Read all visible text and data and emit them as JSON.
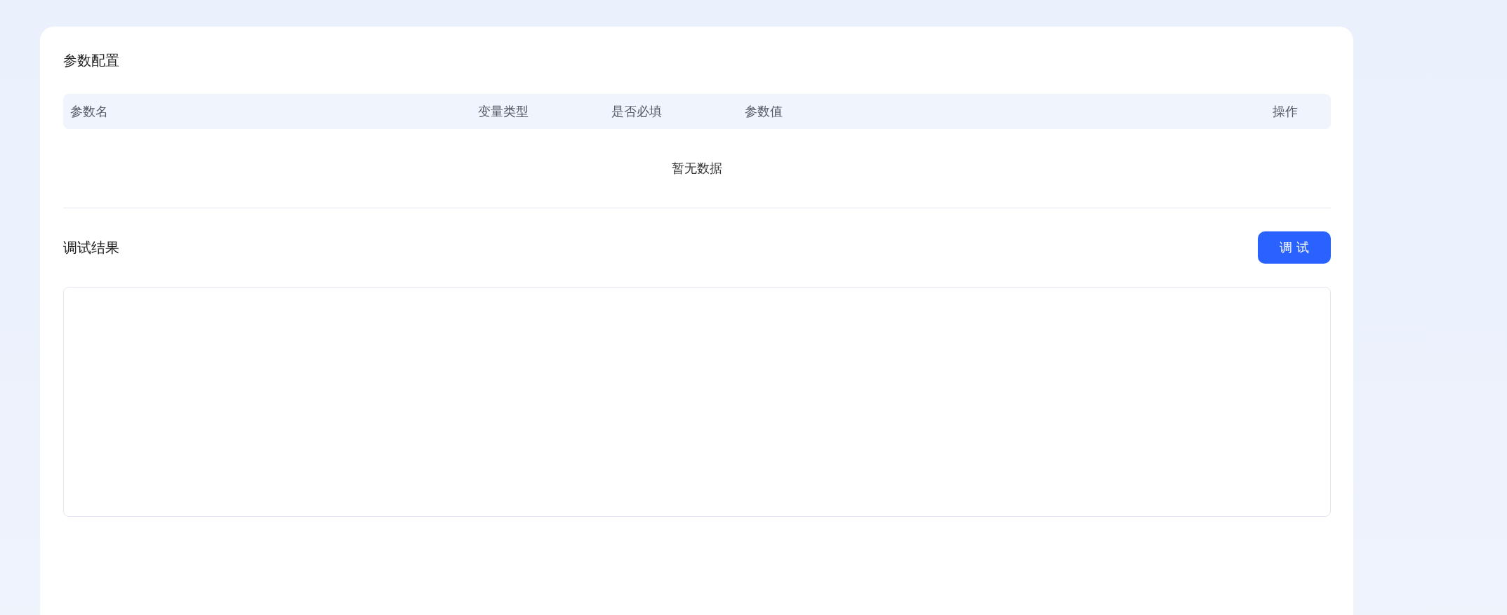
{
  "params_section": {
    "title": "参数配置",
    "table": {
      "columns": [
        "参数名",
        "变量类型",
        "是否必填",
        "参数值",
        "操作"
      ],
      "empty_text": "暂无数据"
    }
  },
  "debug_section": {
    "title": "调试结果",
    "button": "调 试"
  }
}
